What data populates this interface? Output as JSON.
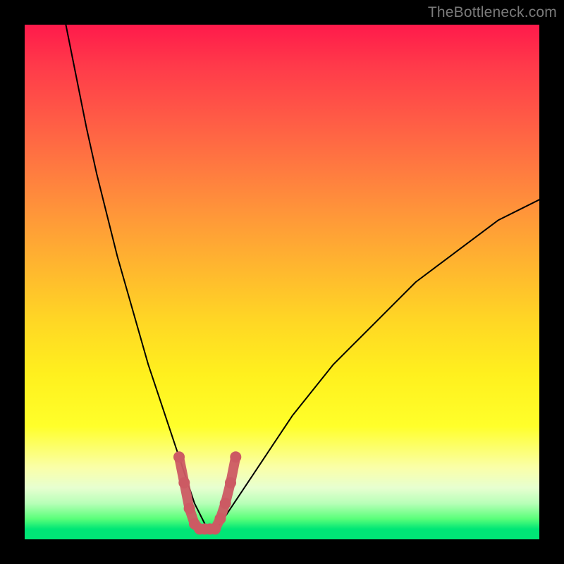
{
  "watermark": "TheBottleneck.com",
  "colors": {
    "curve": "#000000",
    "marker": "#cc5a63",
    "background_top": "#ff1a4b",
    "background_bottom": "#00e676"
  },
  "chart_data": {
    "type": "line",
    "title": "",
    "xlabel": "",
    "ylabel": "",
    "xlim": [
      0,
      100
    ],
    "ylim": [
      0,
      100
    ],
    "series": [
      {
        "name": "bottleneck-curve",
        "x": [
          8,
          10,
          12,
          14,
          16,
          18,
          20,
          22,
          24,
          26,
          28,
          30,
          31,
          32,
          33,
          34,
          35,
          36,
          37,
          38,
          40,
          44,
          48,
          52,
          56,
          60,
          64,
          68,
          72,
          76,
          80,
          84,
          88,
          92,
          96,
          100
        ],
        "values": [
          100,
          90,
          80,
          71,
          63,
          55,
          48,
          41,
          34,
          28,
          22,
          16,
          13,
          10,
          7,
          5,
          3,
          2,
          2,
          3,
          6,
          12,
          18,
          24,
          29,
          34,
          38,
          42,
          46,
          50,
          53,
          56,
          59,
          62,
          64,
          66
        ]
      }
    ],
    "markers": {
      "name": "highlighted-points",
      "x": [
        30,
        31,
        32,
        33,
        34,
        35,
        36,
        37,
        38,
        39,
        40,
        41
      ],
      "values": [
        16,
        11,
        6,
        3,
        2,
        2,
        2,
        2,
        4,
        7,
        11,
        16
      ]
    }
  }
}
